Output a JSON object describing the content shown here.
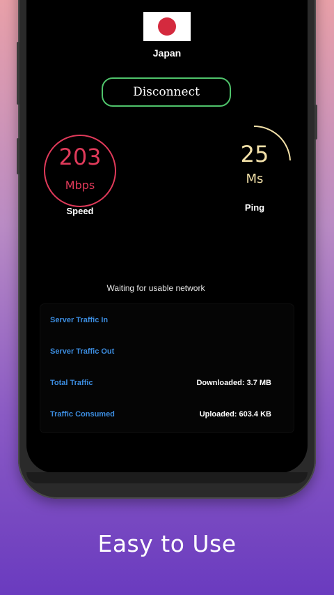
{
  "server": {
    "country": "Japan",
    "flag_icon": "japan-flag-icon"
  },
  "actions": {
    "disconnect_label": "Disconnect"
  },
  "speed": {
    "value": "203",
    "unit": "Mbps",
    "label": "Speed"
  },
  "ping": {
    "value": "25",
    "unit": "Ms",
    "label": "Ping"
  },
  "status": {
    "text": "Waiting for usable network"
  },
  "traffic": {
    "rows": [
      {
        "label": "Server Traffic In",
        "value": ""
      },
      {
        "label": "Server Traffic Out",
        "value": ""
      },
      {
        "label": "Total Traffic",
        "value": "Downloaded: 3.7 MB"
      },
      {
        "label": "Traffic Consumed",
        "value": "Uploaded: 603.4 KB"
      }
    ]
  },
  "caption": {
    "text": "Easy to Use"
  },
  "colors": {
    "accent_green": "#4fc36b",
    "speed_red": "#e03a5a",
    "ping_yellow": "#f2e0a8",
    "label_blue": "#3c8de0"
  }
}
